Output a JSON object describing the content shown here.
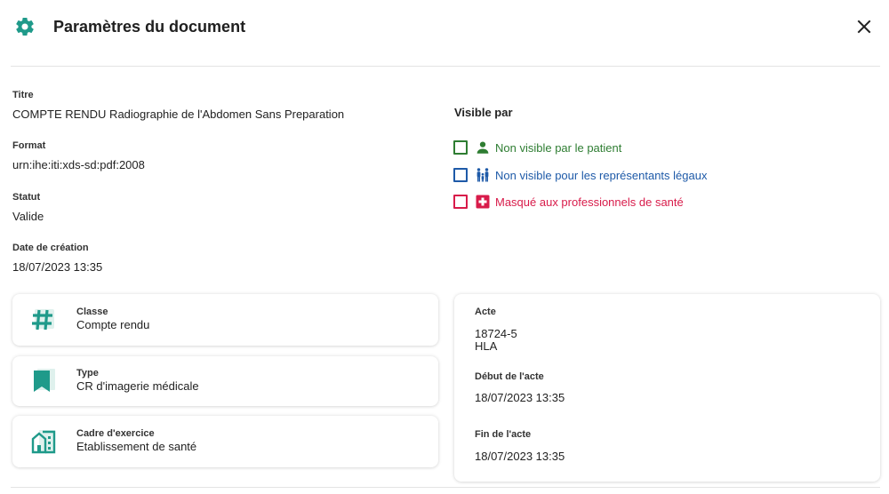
{
  "header": {
    "title": "Paramètres du document",
    "gear_icon": "gear-icon",
    "close_icon": "close-icon",
    "accent_color": "#1f9a8a"
  },
  "document": {
    "titre_label": "Titre",
    "titre_value": "COMPTE RENDU Radiographie de l'Abdomen Sans Preparation",
    "format_label": "Format",
    "format_value": "urn:ihe:iti:xds-sd:pdf:2008",
    "statut_label": "Statut",
    "statut_value": "Valide",
    "date_label": "Date de création",
    "date_value": "18/07/2023 13:35"
  },
  "visibility": {
    "title": "Visible par",
    "options": [
      {
        "label": "Non visible par le patient",
        "icon": "person-icon",
        "color": "#2e7d32",
        "checked": false
      },
      {
        "label": "Non visible pour les représentants légaux",
        "icon": "family-icon",
        "color": "#1e5aa8",
        "checked": false
      },
      {
        "label": "Masqué aux professionnels de santé",
        "icon": "medical-cross-icon",
        "color": "#d81b4a",
        "checked": false
      }
    ]
  },
  "cards": [
    {
      "label": "Classe",
      "value": "Compte rendu",
      "icon": "hashtag-icon"
    },
    {
      "label": "Type",
      "value": "CR d'imagerie médicale",
      "icon": "bookmark-icon"
    },
    {
      "label": "Cadre d'exercice",
      "value": "Etablissement de santé",
      "icon": "building-icon"
    }
  ],
  "acte": {
    "acte_label": "Acte",
    "acte_code": "18724-5",
    "acte_name": "HLA",
    "debut_label": "Début de l'acte",
    "debut_value": "18/07/2023 13:35",
    "fin_label": "Fin de l'acte",
    "fin_value": "18/07/2023 13:35"
  }
}
